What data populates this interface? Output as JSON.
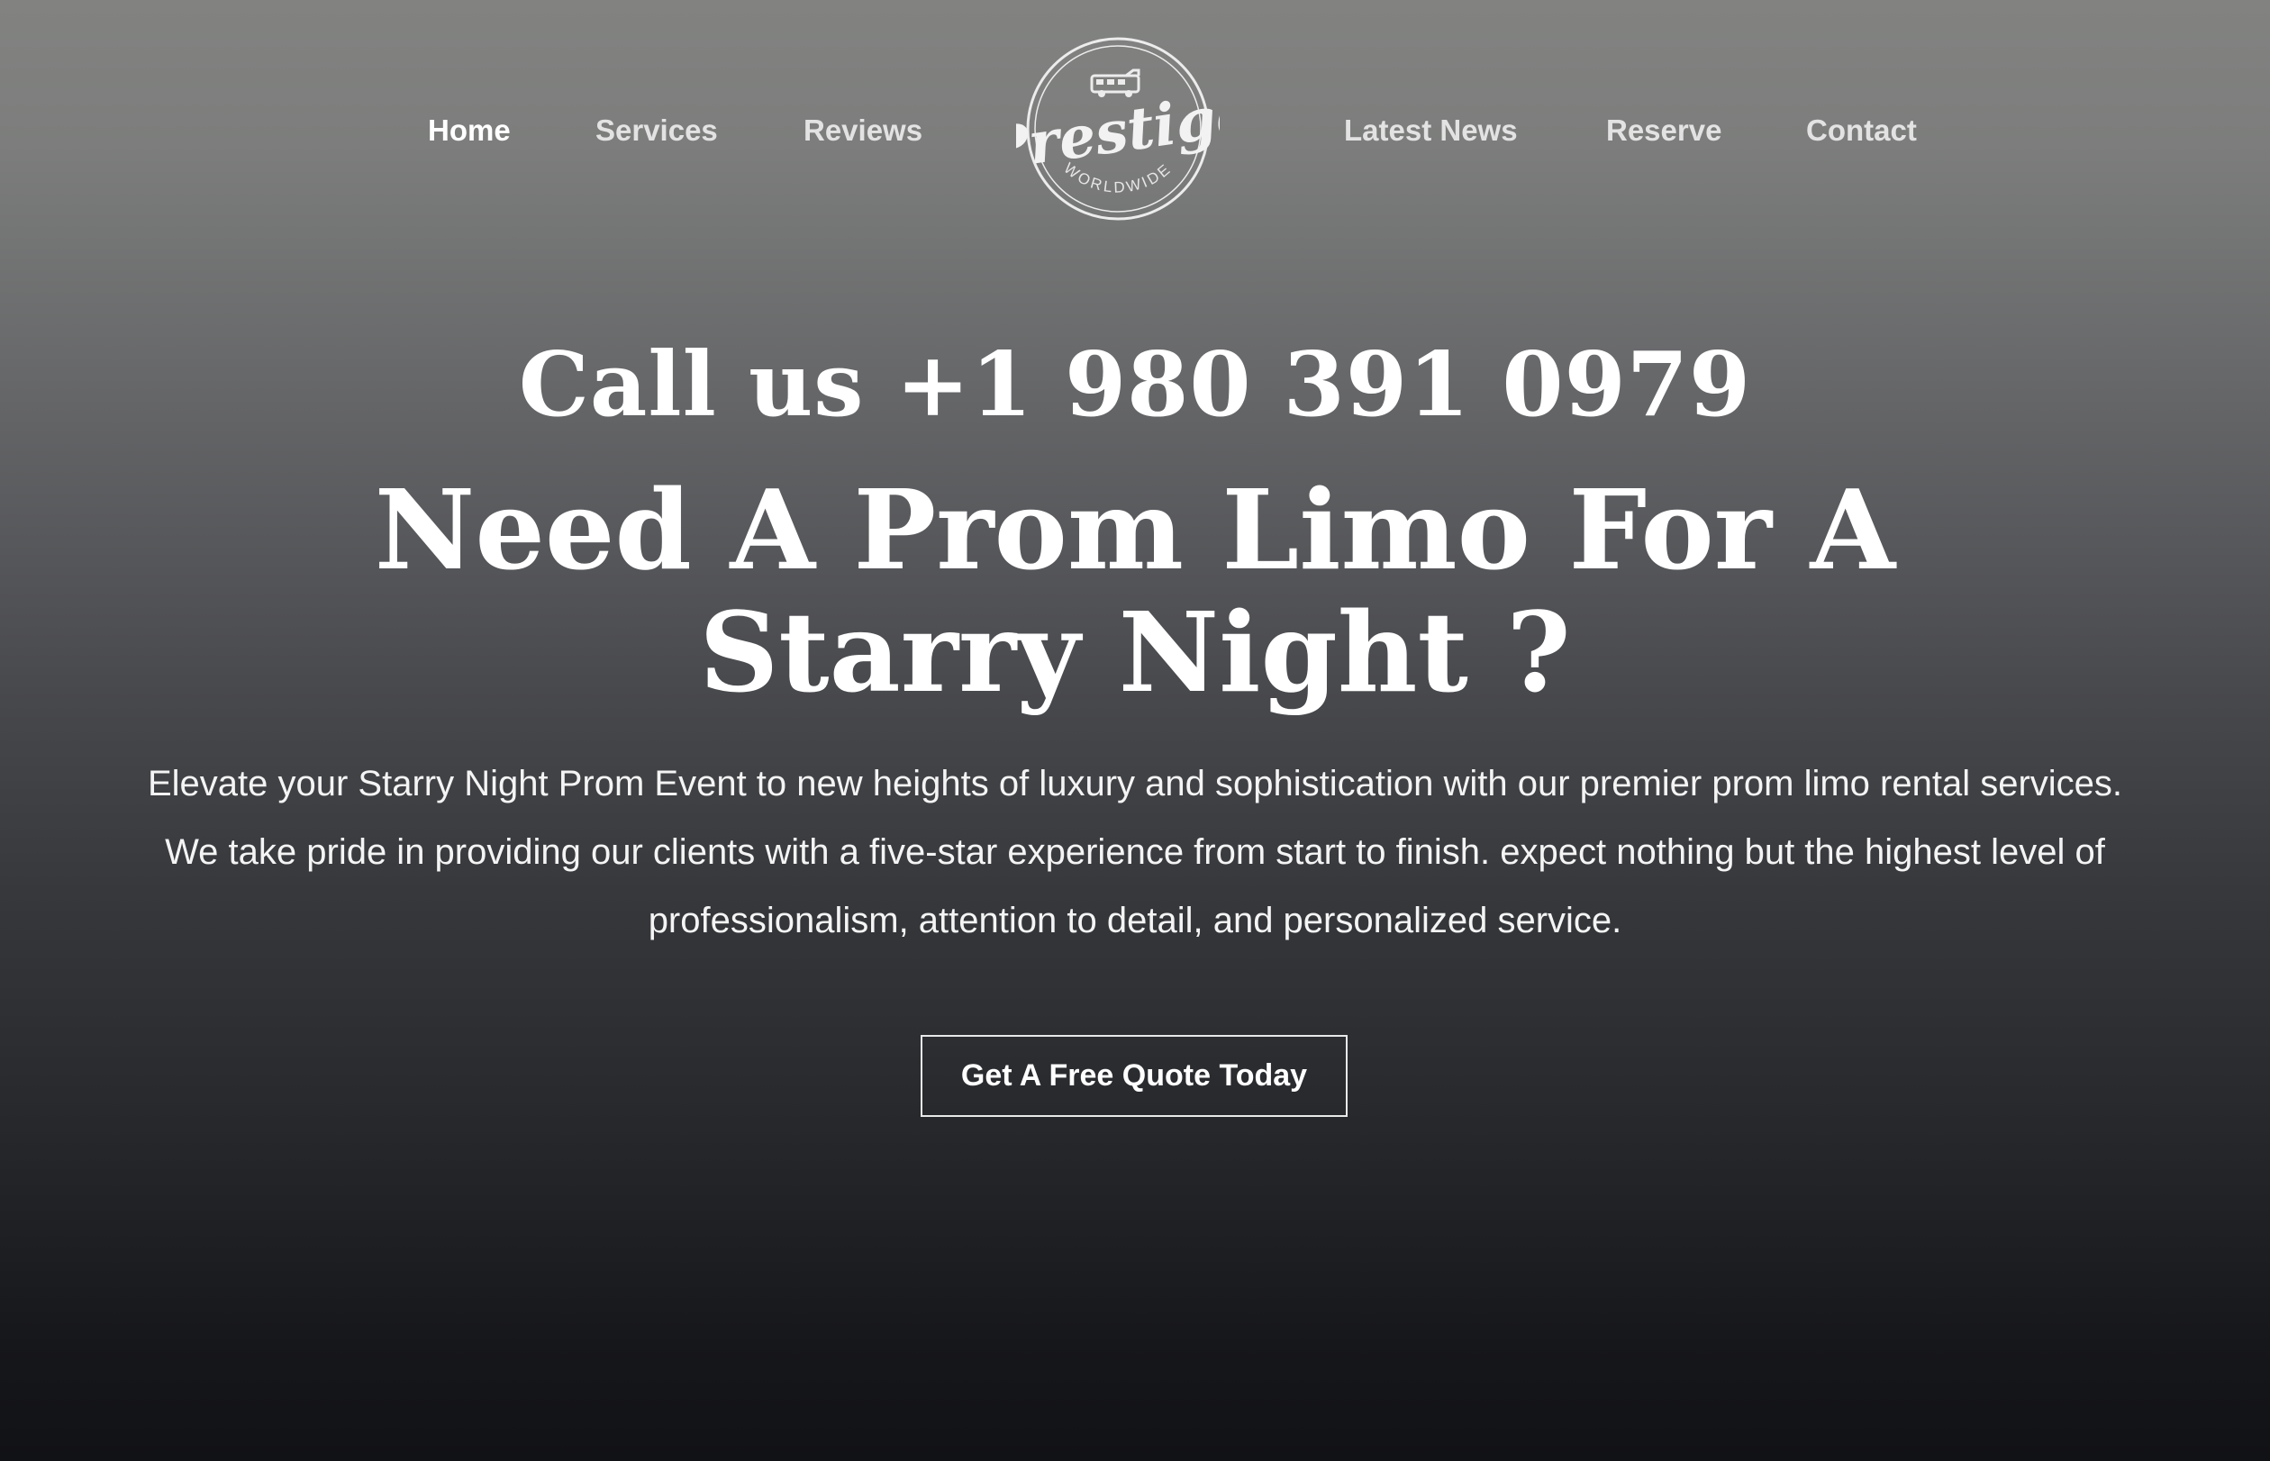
{
  "nav": {
    "left": [
      {
        "label": "Home",
        "active": true
      },
      {
        "label": "Services"
      },
      {
        "label": "Reviews"
      }
    ],
    "right": [
      {
        "label": "Latest News"
      },
      {
        "label": "Reserve"
      },
      {
        "label": "Contact"
      }
    ],
    "logo": {
      "wordmark": "Prestige",
      "tagline": "WORLDWIDE",
      "icon": "limo-bus-icon"
    }
  },
  "hero": {
    "call": "Call us +1 980 391 0979",
    "headline_line1": "Need A Prom Limo For A",
    "headline_line2": "Starry Night ?",
    "description": "Elevate your Starry Night Prom Event to new heights of luxury and sophistication with our premier prom limo rental services. We take pride in providing our clients with a five-star experience from start to finish. expect nothing but the highest level of professionalism, attention to detail, and personalized service.",
    "cta_label": "Get A Free Quote Today"
  },
  "colors": {
    "background_top": "#828381",
    "background_bottom": "#111216",
    "text": "#ffffff",
    "cta_border": "#e9e9e9"
  }
}
